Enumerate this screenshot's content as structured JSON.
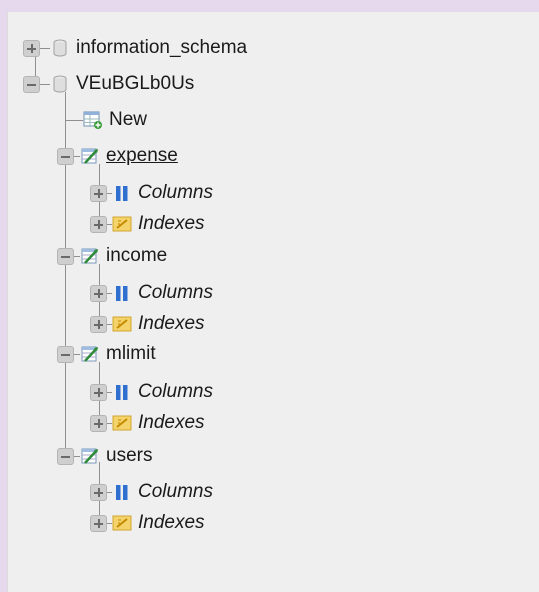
{
  "tree": {
    "databases": [
      {
        "name": "information_schema",
        "expanded": false
      },
      {
        "name": "VEuBGLb0Us",
        "expanded": true
      }
    ],
    "new_label": "New",
    "tables": [
      {
        "name": "expense",
        "underlined": true
      },
      {
        "name": "income"
      },
      {
        "name": "mlimit"
      },
      {
        "name": "users"
      }
    ],
    "columns_label": "Columns",
    "indexes_label": "Indexes"
  },
  "icons": {
    "expand": "plus-expander-icon",
    "collapse": "minus-expander-icon",
    "database": "database-icon",
    "new": "new-table-icon",
    "table": "table-icon",
    "columns": "columns-icon",
    "indexes": "indexes-icon"
  }
}
